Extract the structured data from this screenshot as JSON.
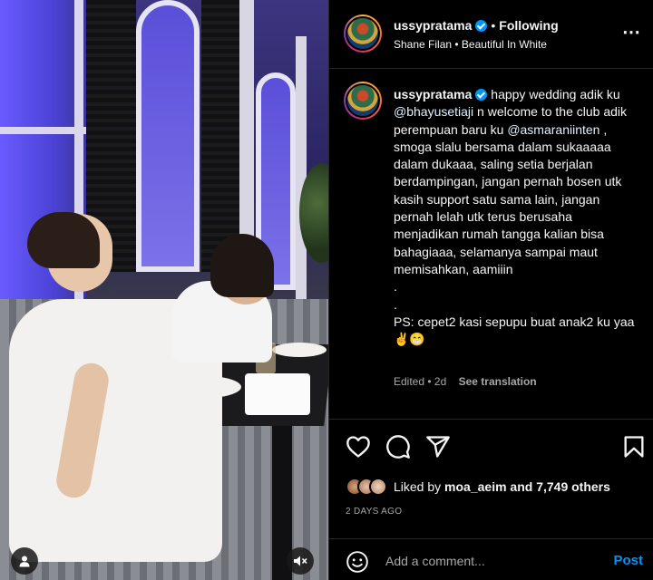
{
  "post": {
    "author": {
      "username": "ussypratama",
      "verified": true,
      "follow_status": "Following",
      "audio": "Shane Filan • Beautiful In White"
    },
    "caption": {
      "username": "ussypratama",
      "part1": "happy wedding adik ku ",
      "mention1": "@bhayusetiaji",
      "part2": " n welcome to the club adik perempuan baru ku ",
      "mention2": "@asmaraniinten",
      "part3": " , smoga slalu bersama dalam sukaaaaa dalam dukaaa, saling setia berjalan berdampingan, jangan pernah bosen utk kasih support satu sama lain, jangan pernah lelah utk terus berusaha menjadikan rumah tangga kalian bisa bahagiaaa, selamanya sampai maut memisahkan, aamiiin\n.\n.\nPS: cepet2 kasi sepupu buat anak2 ku yaa✌️😁"
    },
    "meta": {
      "edited": "Edited • 2d",
      "see_translation": "See translation"
    },
    "likes": {
      "prefix": "Liked by ",
      "liker": "moa_aeim",
      "suffix": " and 7,749 others"
    },
    "time_ago": "2 DAYS AGO",
    "comment": {
      "placeholder": "Add a comment...",
      "post_label": "Post"
    }
  },
  "icons": {
    "more": "more-options-icon",
    "like": "heart-icon",
    "comment": "comment-icon",
    "share": "share-icon",
    "save": "bookmark-icon",
    "emoji": "emoji-icon",
    "user_tag": "user-tag-icon",
    "mute": "muted-speaker-icon"
  },
  "colors": {
    "accent": "#0095f6",
    "background": "#000000",
    "secondary_text": "#a8a8a8"
  }
}
